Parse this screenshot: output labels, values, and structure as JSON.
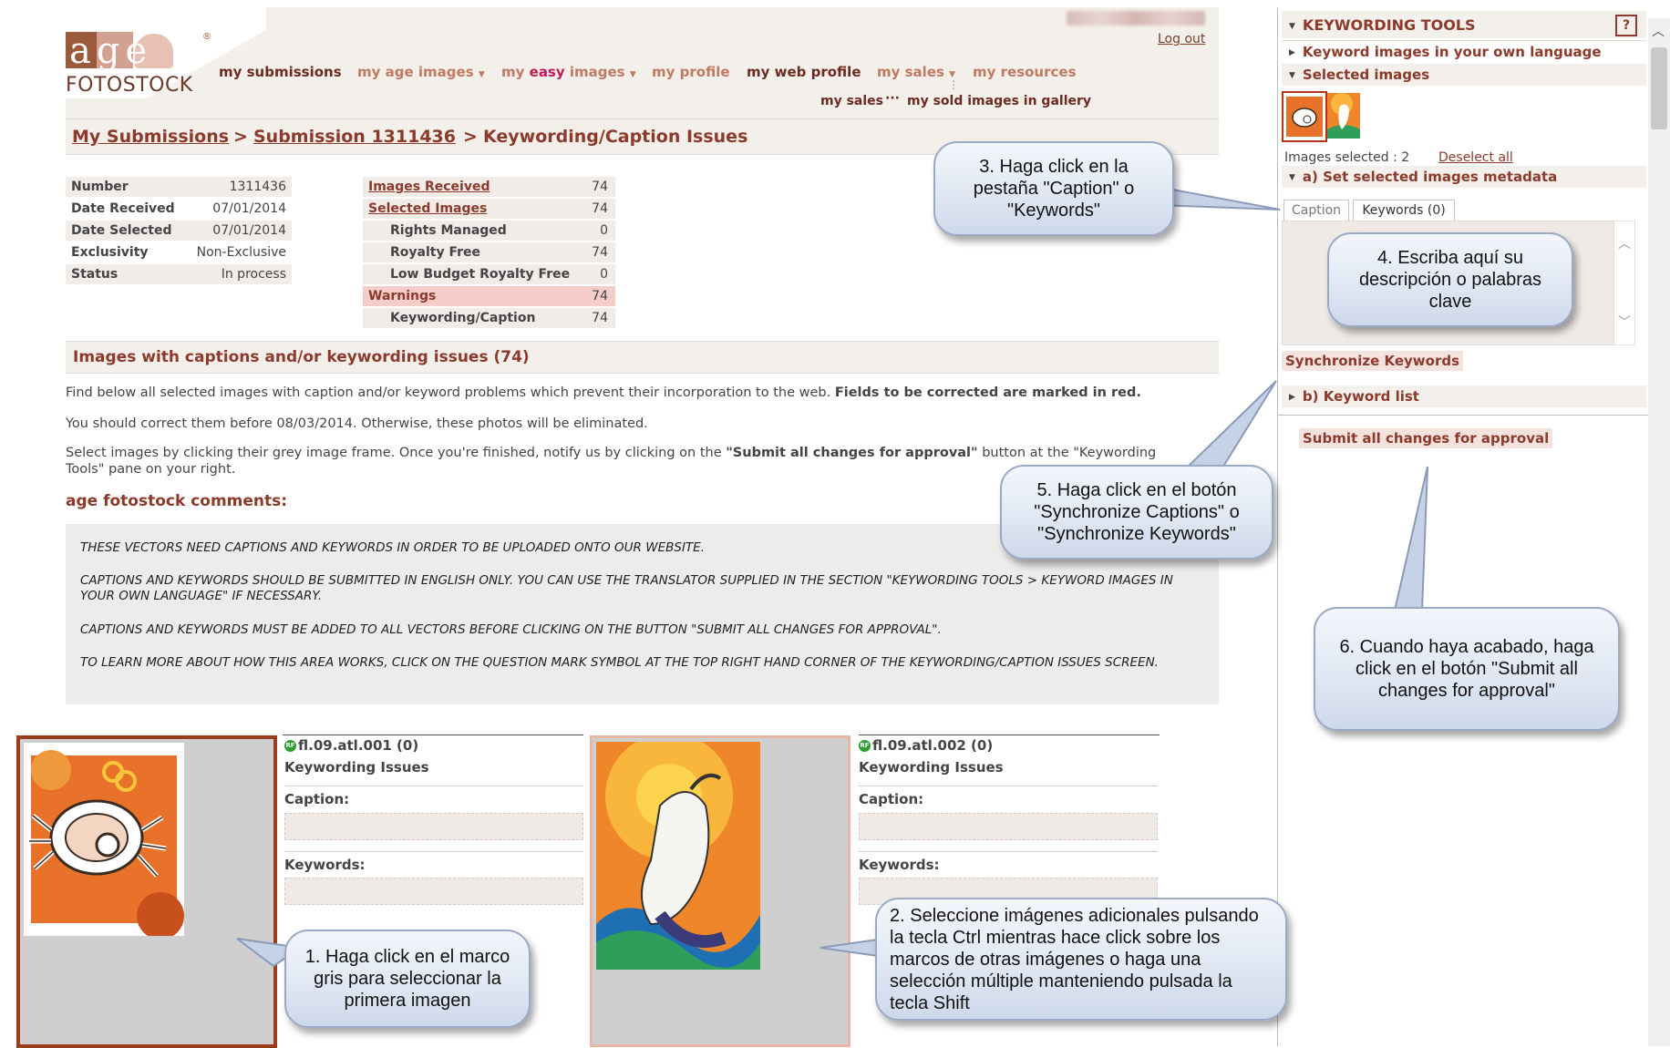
{
  "header": {
    "logout": "Log out",
    "logo": {
      "letters": "age",
      "text": "FOTOSTOCK",
      "reg": "®"
    },
    "nav": [
      {
        "label": "my submissions",
        "arrow": ""
      },
      {
        "label": "my age images",
        "arrow": "▼"
      },
      {
        "label_prefix": "my ",
        "label_em": "easy",
        "label_suffix": " images",
        "arrow": "▼"
      },
      {
        "label": "my profile",
        "arrow": ""
      },
      {
        "label": "my web profile",
        "arrow": ""
      },
      {
        "label": "my sales",
        "arrow": "▼"
      },
      {
        "label": "my resources",
        "arrow": ""
      }
    ],
    "subnav": {
      "left": "my sales",
      "ellipsis": "···",
      "right": "my sold images in gallery",
      "divider": "⋮"
    }
  },
  "breadcrumb": {
    "crumb1": "My Submissions",
    "sep1": ">",
    "crumb2": "Submission 1311436",
    "sep2": ">",
    "current": "Keywording/Caption Issues"
  },
  "info_left": [
    {
      "label": "Number",
      "value": "1311436"
    },
    {
      "label": "Date Received",
      "value": "07/01/2014"
    },
    {
      "label": "Date Selected",
      "value": "07/01/2014"
    },
    {
      "label": "Exclusivity",
      "value": "Non-Exclusive"
    },
    {
      "label": "Status",
      "value": "In process"
    }
  ],
  "info_right": [
    {
      "label": "Images Received",
      "value": "74"
    },
    {
      "label": "Selected Images",
      "value": "74"
    },
    {
      "label": "Rights Managed",
      "value": "0"
    },
    {
      "label": "Royalty Free",
      "value": "74"
    },
    {
      "label": "Low Budget Royalty Free",
      "value": "0"
    },
    {
      "label": "Warnings",
      "value": "74"
    },
    {
      "label": "Keywording/Caption",
      "value": "74"
    }
  ],
  "section": {
    "title": "Images with captions and/or keywording issues (74)",
    "p1": "Find below all selected images with caption and/or keyword problems which prevent their incorporation to the web.",
    "p1_bold": "Fields to be corrected are marked in red.",
    "p2": "You should correct them before 08/03/2014. Otherwise, these photos will be eliminated.",
    "p3_a": "Select images by clicking their grey image frame. Once you're finished, notify us by clicking on the",
    "p3_b": "\"Submit all changes for approval\"",
    "p3_c": "button at the \"Keywording",
    "p3_d": "Tools\" pane on your right.",
    "comments_title": "age fotostock comments:",
    "comments": [
      "THESE VECTORS NEED CAPTIONS AND KEYWORDS IN ORDER TO BE UPLOADED ONTO OUR WEBSITE.",
      "CAPTIONS AND KEYWORDS SHOULD BE SUBMITTED IN ENGLISH ONLY. YOU CAN USE THE TRANSLATOR SUPPLIED IN THE SECTION \"KEYWORDING TOOLS > KEYWORD IMAGES IN YOUR OWN LANGUAGE\" IF NECESSARY.",
      "CAPTIONS AND KEYWORDS MUST BE ADDED TO ALL VECTORS BEFORE CLICKING ON THE BUTTON \"SUBMIT ALL CHANGES FOR APPROVAL\".",
      "TO LEARN MORE ABOUT HOW THIS AREA WORKS, CLICK ON THE QUESTION MARK SYMBOL AT THE TOP RIGHT HAND CORNER OF THE KEYWORDING/CAPTION ISSUES SCREEN."
    ]
  },
  "cards": [
    {
      "badge": "RF",
      "name": "fl.09.atl.001 (0)",
      "issues": "Keywording Issues",
      "caption_label": "Caption:",
      "keywords_label": "Keywords:"
    },
    {
      "badge": "RF",
      "name": "fl.09.atl.002 (0)",
      "issues": "Keywording Issues",
      "caption_label": "Caption:",
      "keywords_label": "Keywords:"
    }
  ],
  "right_panel": {
    "title": "KEYWORDING TOOLS",
    "help": "?",
    "item1": "Keyword images in your own language",
    "item2": "Selected images",
    "selected_count": "Images selected : 2",
    "deselect": "Deselect all",
    "meta": "a) Set selected images metadata",
    "tab_caption": "Caption",
    "tab_keywords": "Keywords (0)",
    "sync": "Synchronize Keywords",
    "keyword_list": "b) Keyword list",
    "submit": "Submit all changes for approval"
  },
  "callouts": {
    "c1": "1. Haga click en el marco gris para seleccionar la primera imagen",
    "c2": "2. Seleccione imágenes adicionales pulsando la tecla Ctrl mientras hace click sobre los marcos de otras imágenes o haga una selección múltiple manteniendo pulsada la tecla Shift",
    "c3": "3. Haga click en la pestaña \"Caption\" o \"Keywords\"",
    "c4": "4. Escriba aquí su descripción o palabras clave",
    "c5": "5. Haga click en el botón \"Synchronize Captions\" o \"Synchronize Keywords\"",
    "c6": "6. Cuando haya acabado, haga click en el botón \"Submit all changes for approval\""
  },
  "colors": {
    "brand": "#8b3a2b",
    "accent": "#c07a62",
    "panel_bg": "#f3efea",
    "warning_bg": "#f4ccc9",
    "selected_frame": "#9b3d1d"
  }
}
